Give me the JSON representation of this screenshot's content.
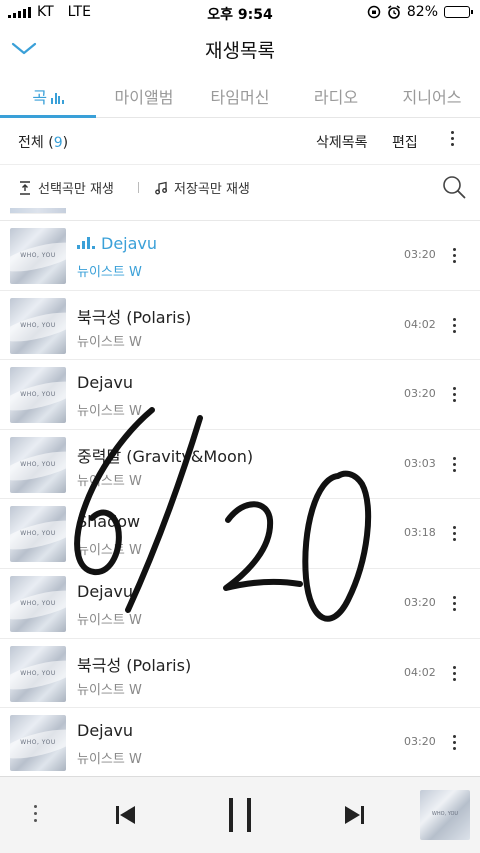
{
  "status_bar": {
    "carrier": "KT",
    "network": "LTE",
    "time": "오후 9:54",
    "battery": "82%",
    "battery_level": 0.82
  },
  "header": {
    "title": "재생목록",
    "collapse_icon": "chevron-down-icon"
  },
  "tabs": [
    {
      "label": "곡",
      "active": true
    },
    {
      "label": "마이앨범",
      "active": false
    },
    {
      "label": "타임머신",
      "active": false
    },
    {
      "label": "라디오",
      "active": false
    },
    {
      "label": "지니어스",
      "active": false
    }
  ],
  "list_toolbar": {
    "all_label": "전체 (",
    "count": "9",
    "all_close": ")",
    "delete_list_label": "삭제목록",
    "edit_label": "편집"
  },
  "actions": {
    "play_selected_label": "선택곡만 재생",
    "play_saved_label": "저장곡만 재생",
    "search_icon": "search-icon"
  },
  "songs": [
    {
      "title": "Dejavu",
      "artist": "뉴이스트 W",
      "duration": "03:20",
      "playing": true
    },
    {
      "title": "북극성 (Polaris)",
      "artist": "뉴이스트 W",
      "duration": "04:02",
      "playing": false
    },
    {
      "title": "Dejavu",
      "artist": "뉴이스트 W",
      "duration": "03:20",
      "playing": false
    },
    {
      "title": "중력달 (Gravity&Moon)",
      "artist": "뉴이스트 W",
      "duration": "03:03",
      "playing": false
    },
    {
      "title": "Shadow",
      "artist": "뉴이스트 W",
      "duration": "03:18",
      "playing": false
    },
    {
      "title": "Dejavu",
      "artist": "뉴이스트 W",
      "duration": "03:20",
      "playing": false
    },
    {
      "title": "북극성 (Polaris)",
      "artist": "뉴이스트 W",
      "duration": "04:02",
      "playing": false
    },
    {
      "title": "Dejavu",
      "artist": "뉴이스트 W",
      "duration": "03:20",
      "playing": false
    }
  ],
  "album_art_text": "WHO, YOU",
  "player": {
    "more_icon": "more-vertical-icon",
    "prev_icon": "skip-previous-icon",
    "pause_icon": "pause-icon",
    "next_icon": "skip-next-icon"
  },
  "handwriting": "6/20",
  "colors": {
    "accent": "#3aa0d8",
    "text": "#222222",
    "muted": "#888888"
  }
}
